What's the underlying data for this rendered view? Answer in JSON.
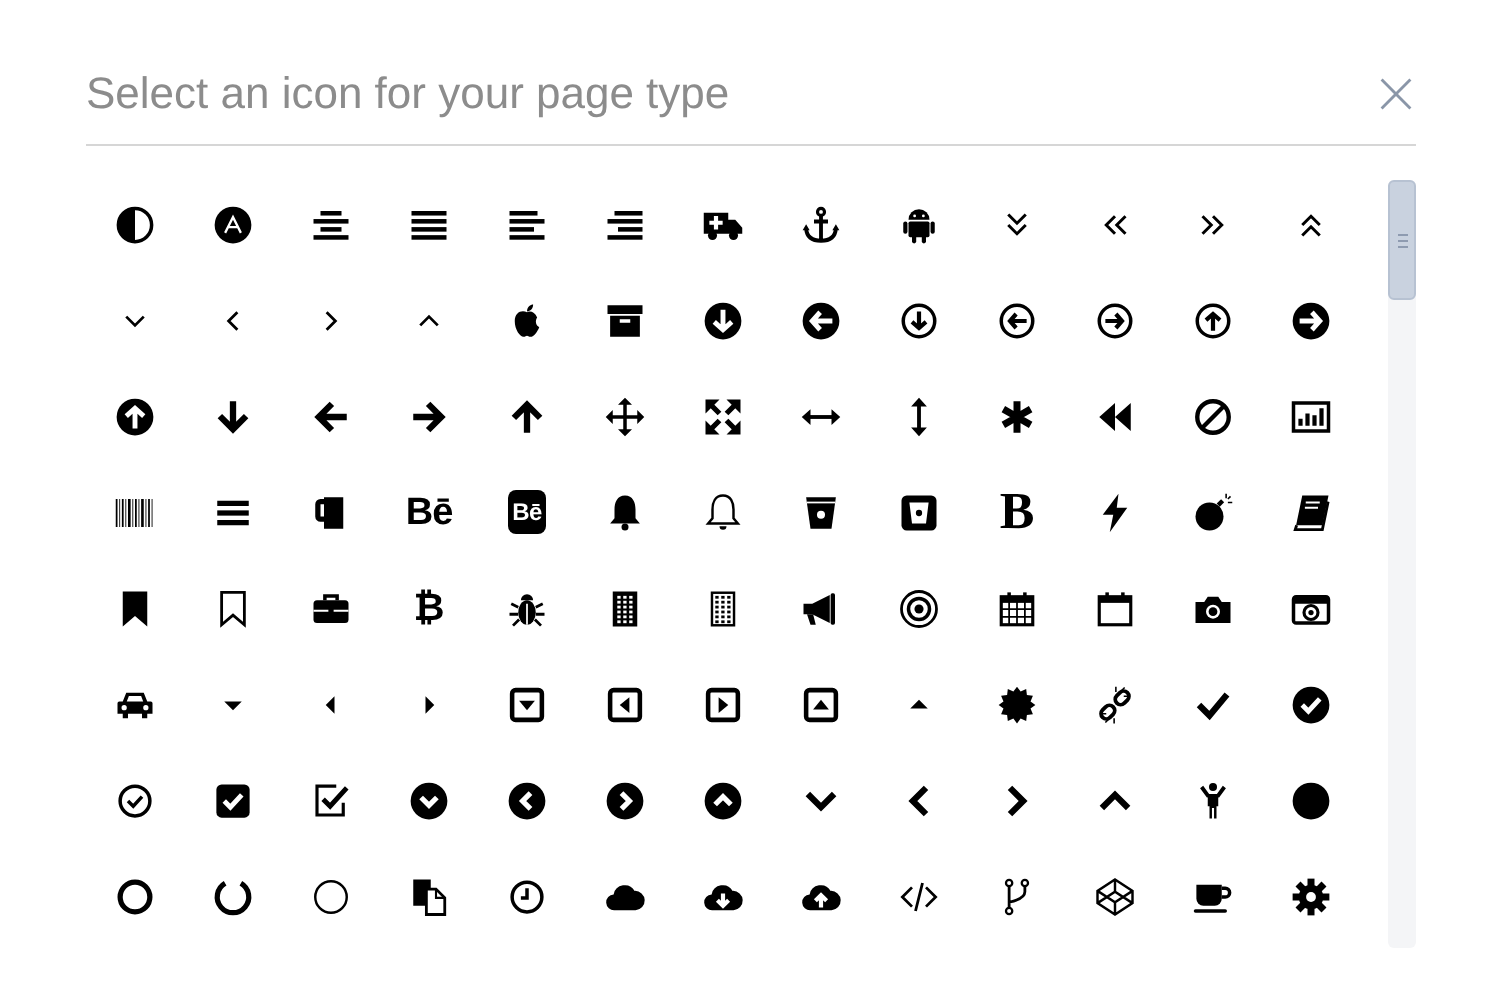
{
  "search": {
    "placeholder": "Select an icon for your page type"
  },
  "icons": [
    {
      "kind": "contrast"
    },
    {
      "kind": "triangle-circle"
    },
    {
      "kind": "align-center"
    },
    {
      "kind": "align-justify"
    },
    {
      "kind": "align-left"
    },
    {
      "kind": "align-right"
    },
    {
      "kind": "ambulance"
    },
    {
      "kind": "anchor"
    },
    {
      "kind": "robot"
    },
    {
      "kind": "double-chevron-down"
    },
    {
      "kind": "double-chevron-left"
    },
    {
      "kind": "double-chevron-right"
    },
    {
      "kind": "double-chevron-up"
    },
    {
      "kind": "thin-chevron-down"
    },
    {
      "kind": "thin-chevron-left"
    },
    {
      "kind": "thin-chevron-right"
    },
    {
      "kind": "thin-chevron-up"
    },
    {
      "kind": "apple"
    },
    {
      "kind": "archive"
    },
    {
      "kind": "circle-arrow-down"
    },
    {
      "kind": "circle-arrow-left"
    },
    {
      "kind": "outlined-circle-arrow-down"
    },
    {
      "kind": "outlined-circle-arrow-left"
    },
    {
      "kind": "outlined-circle-arrow-right"
    },
    {
      "kind": "outlined-circle-arrow-up"
    },
    {
      "kind": "circle-arrow-right"
    },
    {
      "kind": "circle-arrow-up"
    },
    {
      "kind": "arrow-down"
    },
    {
      "kind": "arrow-left"
    },
    {
      "kind": "arrow-right"
    },
    {
      "kind": "arrow-up"
    },
    {
      "kind": "move"
    },
    {
      "kind": "expand"
    },
    {
      "kind": "horizontal-arrows"
    },
    {
      "kind": "vertical-arrows"
    },
    {
      "kind": "asterisk"
    },
    {
      "kind": "backward"
    },
    {
      "kind": "ban"
    },
    {
      "kind": "bar-chart"
    },
    {
      "kind": "barcode"
    },
    {
      "kind": "bars"
    },
    {
      "kind": "mug"
    },
    {
      "kind": "logo-glyph",
      "text": "Bē"
    },
    {
      "kind": "logo-badge",
      "text": "Bē"
    },
    {
      "kind": "bell"
    },
    {
      "kind": "outlined-bell"
    },
    {
      "kind": "bucket"
    },
    {
      "kind": "square-bucket"
    },
    {
      "kind": "letter-glyph",
      "text": "B"
    },
    {
      "kind": "bolt"
    },
    {
      "kind": "bomb"
    },
    {
      "kind": "book"
    },
    {
      "kind": "bookmark"
    },
    {
      "kind": "outlined-bookmark"
    },
    {
      "kind": "briefcase"
    },
    {
      "kind": "currency-glyph",
      "text": "₿"
    },
    {
      "kind": "bug"
    },
    {
      "kind": "building"
    },
    {
      "kind": "outlined-building"
    },
    {
      "kind": "bullhorn"
    },
    {
      "kind": "bullseye"
    },
    {
      "kind": "calendar"
    },
    {
      "kind": "empty-calendar"
    },
    {
      "kind": "camera"
    },
    {
      "kind": "retro-camera"
    },
    {
      "kind": "car"
    },
    {
      "kind": "caret-down"
    },
    {
      "kind": "caret-left"
    },
    {
      "kind": "caret-right"
    },
    {
      "kind": "square-caret-down"
    },
    {
      "kind": "square-caret-left"
    },
    {
      "kind": "square-caret-right"
    },
    {
      "kind": "square-caret-up"
    },
    {
      "kind": "caret-up"
    },
    {
      "kind": "certificate"
    },
    {
      "kind": "broken-link"
    },
    {
      "kind": "check"
    },
    {
      "kind": "check-circle"
    },
    {
      "kind": "outlined-check-circle"
    },
    {
      "kind": "check-square"
    },
    {
      "kind": "outlined-check-square"
    },
    {
      "kind": "circle-chevron-down"
    },
    {
      "kind": "circle-chevron-left"
    },
    {
      "kind": "circle-chevron-right"
    },
    {
      "kind": "circle-chevron-up"
    },
    {
      "kind": "chevron-down"
    },
    {
      "kind": "chevron-left"
    },
    {
      "kind": "chevron-right"
    },
    {
      "kind": "chevron-up"
    },
    {
      "kind": "child"
    },
    {
      "kind": "circle"
    },
    {
      "kind": "ring"
    },
    {
      "kind": "circle-notch"
    },
    {
      "kind": "thin-circle"
    },
    {
      "kind": "copy"
    },
    {
      "kind": "clock"
    },
    {
      "kind": "cloud"
    },
    {
      "kind": "cloud-download"
    },
    {
      "kind": "cloud-upload"
    },
    {
      "kind": "code"
    },
    {
      "kind": "code-fork"
    },
    {
      "kind": "cube"
    },
    {
      "kind": "coffee"
    },
    {
      "kind": "gear"
    }
  ]
}
